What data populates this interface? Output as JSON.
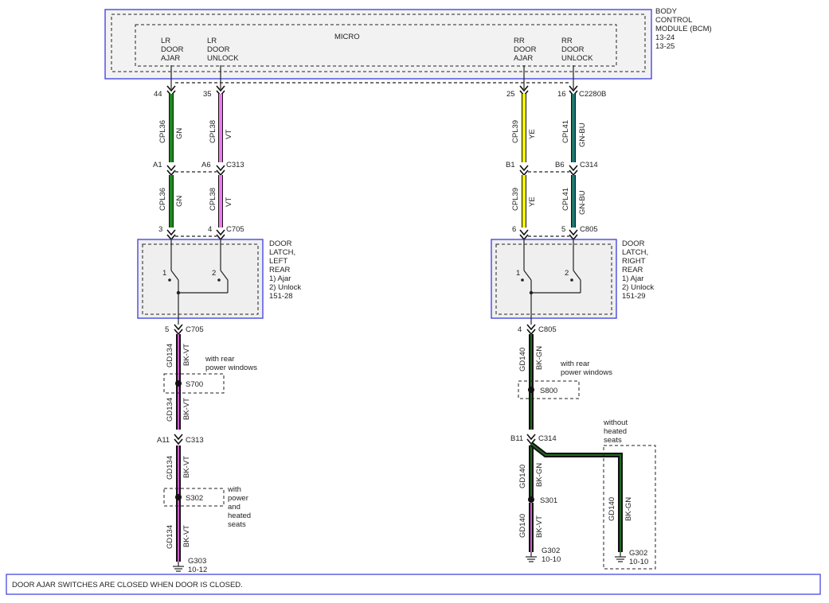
{
  "module": {
    "title": [
      "BODY",
      "CONTROL",
      "MODULE (BCM)",
      "13-24",
      "13-25"
    ],
    "micro_label": "MICRO",
    "pins": {
      "lr_ajar": [
        "LR",
        "DOOR",
        "AJAR"
      ],
      "lr_unlock": [
        "LR",
        "DOOR",
        "UNLOCK"
      ],
      "rr_ajar": [
        "RR",
        "DOOR",
        "AJAR"
      ],
      "rr_unlock": [
        "RR",
        "DOOR",
        "UNLOCK"
      ]
    }
  },
  "connectors": {
    "bcm_pin_44": "44",
    "bcm_pin_35": "35",
    "bcm_pin_25": "25",
    "bcm_pin_16": "16",
    "bcm_connector": "C2280B",
    "c313_a1": "A1",
    "c313_a6": "A6",
    "c313": "C313",
    "c314_b1": "B1",
    "c314_b6": "B6",
    "c314": "C314",
    "c705_3": "3",
    "c705_4": "4",
    "c705": "C705",
    "c805_6": "6",
    "c805_5": "5",
    "c805": "C805",
    "c705_5": "5",
    "c705_b": "C705",
    "c805_4": "4",
    "c805_b": "C805",
    "c313_a11": "A11",
    "c313_b": "C313",
    "c314_b11": "B11",
    "c314_b": "C314"
  },
  "wires": {
    "cpl36": "CPL36",
    "gn": "GN",
    "cpl38": "CPL38",
    "vt": "VT",
    "cpl39": "CPL39",
    "ye": "YE",
    "cpl41": "CPL41",
    "gnbu": "GN-BU",
    "gd134": "GD134",
    "bkvt": "BK-VT",
    "gd140": "GD140",
    "bkgn": "BK-GN"
  },
  "latches": {
    "left": [
      "DOOR",
      "LATCH,",
      "LEFT",
      "REAR",
      "1) Ajar",
      "2) Unlock",
      "151-28"
    ],
    "right": [
      "DOOR",
      "LATCH,",
      "RIGHT",
      "REAR",
      "1) Ajar",
      "2) Unlock",
      "151-29"
    ],
    "switch1": "1",
    "switch2": "2"
  },
  "splices": {
    "s700": "S700",
    "s302": "S302",
    "s800": "S800",
    "s301": "S301",
    "with_rear_power_windows": [
      "with rear",
      "power windows"
    ],
    "with_power_heated_seats": [
      "with",
      "power",
      "and",
      "heated",
      "seats"
    ],
    "without_heated_seats": [
      "without",
      "heated",
      "seats"
    ]
  },
  "grounds": {
    "g303": [
      "G303",
      "10-12"
    ],
    "g302_a": [
      "G302",
      "10-10"
    ],
    "g302_b": [
      "G302",
      "10-10"
    ]
  },
  "note": "DOOR AJAR SWITCHES ARE CLOSED WHEN DOOR IS CLOSED.",
  "colors": {
    "green": "#1e8a1e",
    "violet": "#f07af0",
    "yellow": "#f2f200",
    "greenblue": "#1f7a5a",
    "dark_green": "#145a14",
    "border_blue": "#3a3ae0"
  }
}
